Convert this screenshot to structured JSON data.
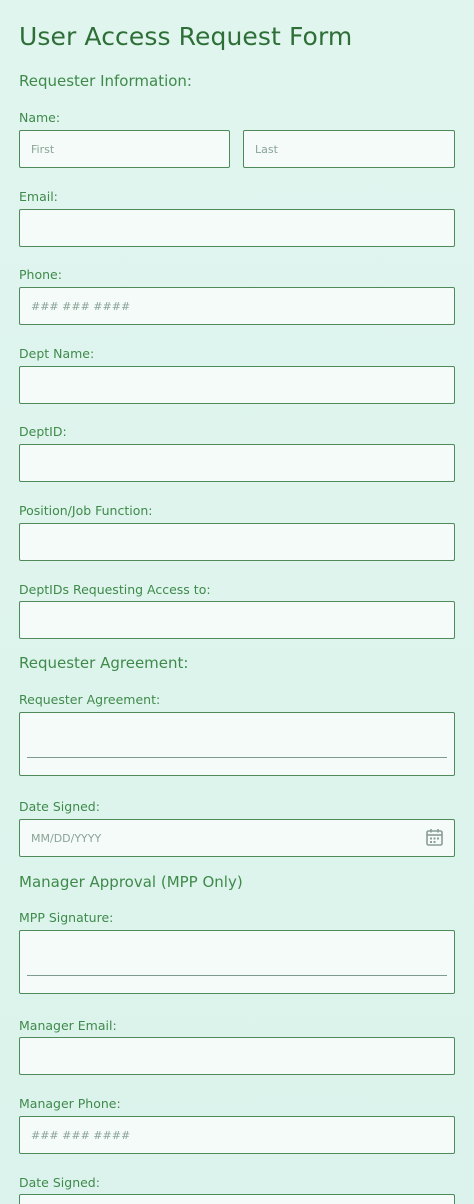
{
  "form": {
    "title": "User Access Request Form",
    "sections": {
      "requester_info": "Requester Information:",
      "requester_agreement": "Requester Agreement:",
      "manager_approval": "Manager Approval (MPP Only)"
    },
    "fields": {
      "name": {
        "label": "Name:",
        "first_placeholder": "First",
        "last_placeholder": "Last"
      },
      "email": {
        "label": "Email:",
        "placeholder": ""
      },
      "phone": {
        "label": "Phone:",
        "placeholder": "### ### ####"
      },
      "dept_name": {
        "label": "Dept Name:",
        "placeholder": ""
      },
      "dept_id": {
        "label": "DeptID:",
        "placeholder": ""
      },
      "position": {
        "label": "Position/Job Function:",
        "placeholder": ""
      },
      "dept_ids_access": {
        "label": "DeptIDs Requesting Access to:",
        "placeholder": ""
      },
      "requester_agreement_sig": {
        "label": "Requester Agreement:"
      },
      "date_signed": {
        "label": "Date Signed:",
        "placeholder": "MM/DD/YYYY",
        "icon": "calendar-icon"
      },
      "mpp_signature": {
        "label": "MPP Signature:"
      },
      "manager_email": {
        "label": "Manager Email:",
        "placeholder": ""
      },
      "manager_phone": {
        "label": "Manager Phone:",
        "placeholder": "### ### ####"
      },
      "manager_date_signed": {
        "label": "Date Signed:",
        "placeholder": ""
      }
    }
  },
  "colors": {
    "background": "#e0f5ee",
    "title": "#2e6f38",
    "label": "#3f8a4a",
    "field_bg": "#f4fbf9",
    "field_border": "#4e8a5a"
  }
}
